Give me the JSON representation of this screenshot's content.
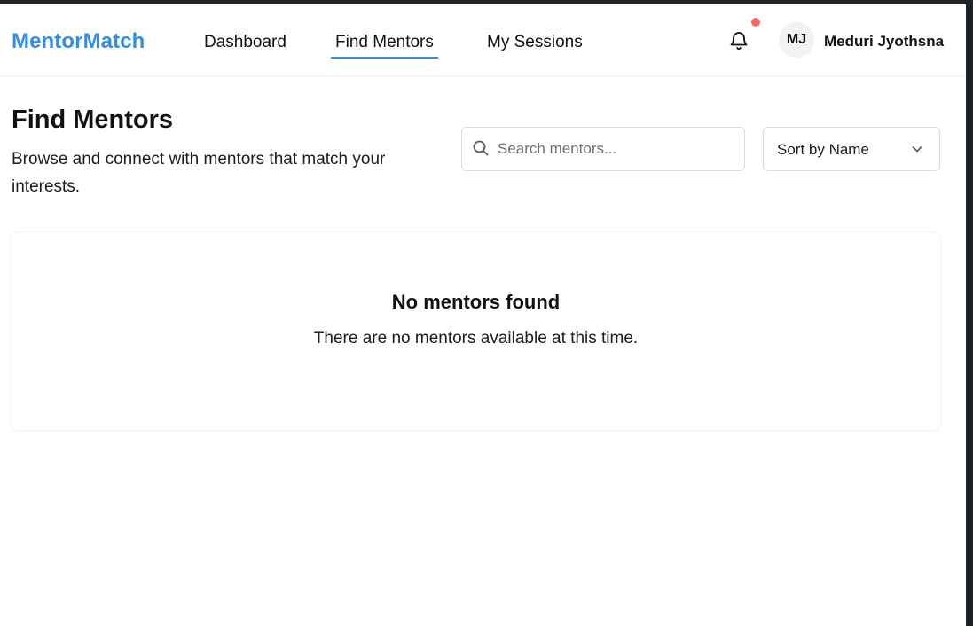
{
  "header": {
    "brand": "MentorMatch",
    "nav": [
      {
        "label": "Dashboard",
        "active": false
      },
      {
        "label": "Find Mentors",
        "active": true
      },
      {
        "label": "My Sessions",
        "active": false
      }
    ],
    "notification_icon": "bell-icon",
    "has_unread_notifications": true,
    "user": {
      "initials": "MJ",
      "name": "Meduri Jyothsna"
    }
  },
  "page": {
    "title": "Find Mentors",
    "subtitle": "Browse and connect with mentors that match your interests."
  },
  "search": {
    "placeholder": "Search mentors...",
    "value": "",
    "icon": "search-icon"
  },
  "sort": {
    "selected": "Sort by Name",
    "icon": "chevron-down-icon"
  },
  "empty_state": {
    "title": "No mentors found",
    "message": "There are no mentors available at this time."
  },
  "colors": {
    "accent": "#2f8fe6",
    "notification_dot": "#f06a6a",
    "text": "#111111"
  }
}
